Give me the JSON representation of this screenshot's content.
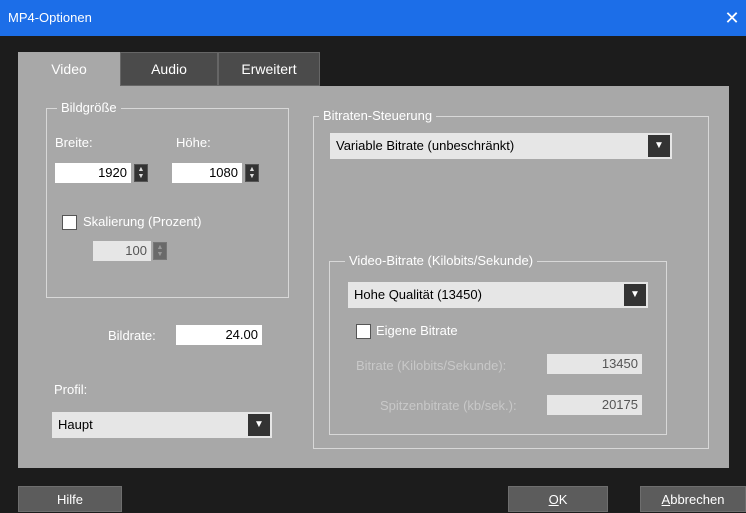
{
  "window": {
    "title": "MP4-Optionen"
  },
  "tabs": [
    {
      "label": "Video"
    },
    {
      "label": "Audio"
    },
    {
      "label": "Erweitert"
    }
  ],
  "bildgroesse": {
    "legend": "Bildgröße",
    "breite_label": "Breite:",
    "hoehe_label": "Höhe:",
    "breite_value": "1920",
    "hoehe_value": "1080",
    "scale_label": "Skalierung (Prozent)",
    "scale_value": "100"
  },
  "bildrate": {
    "label": "Bildrate:",
    "value": "24.00"
  },
  "profil": {
    "label": "Profil:",
    "value": "Haupt"
  },
  "bitrate": {
    "legend": "Bitraten-Steuerung",
    "mode_value": "Variable Bitrate (unbeschränkt)",
    "video": {
      "legend": "Video-Bitrate (Kilobits/Sekunde)",
      "quality_value": "Hohe Qualität (13450)",
      "custom_label": "Eigene Bitrate",
      "bitrate_label": "Bitrate (Kilobits/Sekunde):",
      "bitrate_value": "13450",
      "peak_label": "Spitzenbitrate (kb/sek.):",
      "peak_value": "20175"
    }
  },
  "buttons": {
    "help": "Hilfe",
    "ok_u": "O",
    "ok_rest": "K",
    "cancel_u": "A",
    "cancel_rest": "bbrechen"
  }
}
